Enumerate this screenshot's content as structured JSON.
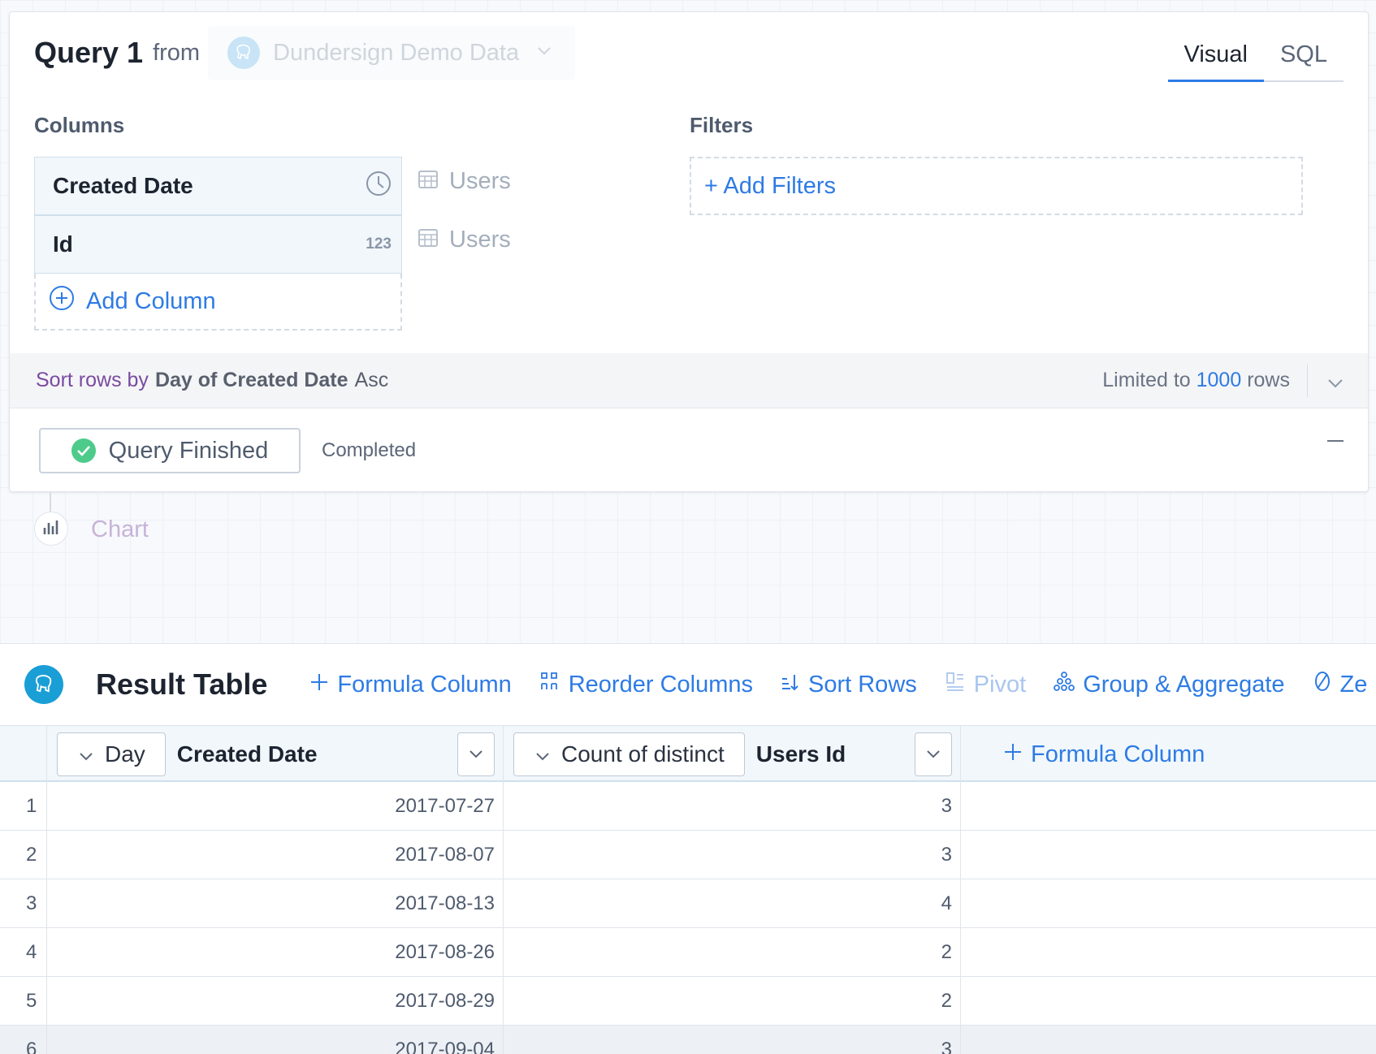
{
  "query": {
    "title": "Query 1",
    "from_label": "from",
    "datasource": "Dundersign Demo Data",
    "tabs": [
      {
        "label": "Visual",
        "active": true
      },
      {
        "label": "SQL",
        "active": false
      }
    ],
    "columns_label": "Columns",
    "filters_label": "Filters",
    "columns": [
      {
        "name": "Created Date",
        "type_icon": "clock-icon",
        "source": "Users"
      },
      {
        "name": "Id",
        "type_badge": "123",
        "source": "Users"
      }
    ],
    "add_column_label": "Add Column",
    "add_filters_label": "+ Add Filters",
    "sort": {
      "prefix": "Sort rows by",
      "field": "Day of Created Date",
      "direction": "Asc"
    },
    "limit": {
      "prefix": "Limited to",
      "count": "1000",
      "suffix": "rows"
    },
    "status": {
      "button_label": "Query Finished",
      "text": "Completed"
    }
  },
  "chart_node": {
    "label": "Chart"
  },
  "result": {
    "title": "Result Table",
    "actions": [
      {
        "label": "Formula Column",
        "icon": "plus-icon",
        "disabled": false
      },
      {
        "label": "Reorder Columns",
        "icon": "reorder-icon",
        "disabled": false
      },
      {
        "label": "Sort Rows",
        "icon": "sort-icon",
        "disabled": false
      },
      {
        "label": "Pivot",
        "icon": "pivot-icon",
        "disabled": true
      },
      {
        "label": "Group & Aggregate",
        "icon": "group-icon",
        "disabled": false
      },
      {
        "label": "Ze",
        "icon": "zero-icon",
        "disabled": false
      }
    ],
    "headers": [
      {
        "aggregation": "Day",
        "name": "Created Date"
      },
      {
        "aggregation": "Count of distinct",
        "name": "Users Id"
      }
    ],
    "add_formula_label": "Formula Column",
    "rows": [
      {
        "index": "1",
        "date": "2017-07-27",
        "count": "3"
      },
      {
        "index": "2",
        "date": "2017-08-07",
        "count": "3"
      },
      {
        "index": "3",
        "date": "2017-08-13",
        "count": "4"
      },
      {
        "index": "4",
        "date": "2017-08-26",
        "count": "2"
      },
      {
        "index": "5",
        "date": "2017-08-29",
        "count": "2"
      },
      {
        "index": "6",
        "date": "2017-09-04",
        "count": "3"
      }
    ]
  },
  "colors": {
    "accent": "#2d7be5",
    "success": "#4ecb8a",
    "sort_prefix": "#7a4ba0"
  }
}
